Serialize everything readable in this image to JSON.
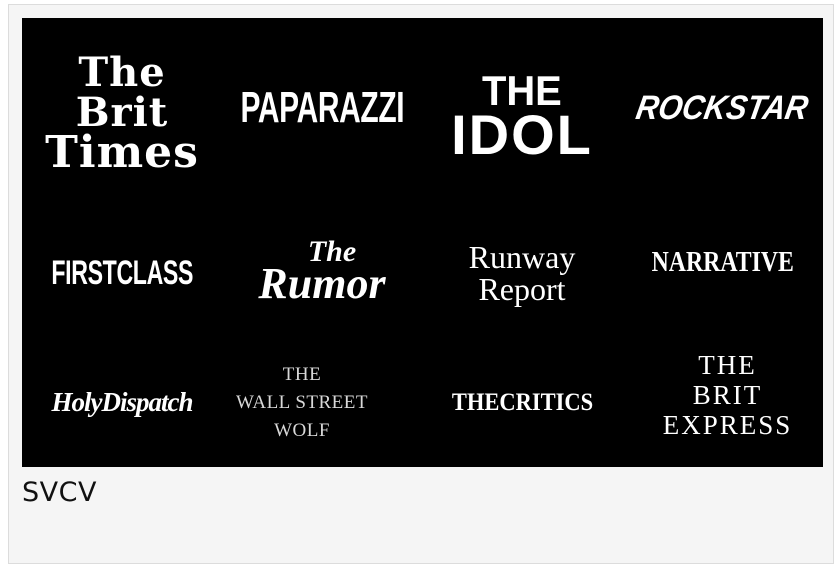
{
  "image": {
    "logos": {
      "brit_times": [
        "The",
        "Brit",
        "Times"
      ],
      "paparazzi": "PAPARAZZI",
      "idol": [
        "THE",
        "IDOL"
      ],
      "rockstar": "ROCKSTAR",
      "firstclass": "FIRSTCLASS",
      "rumor": [
        "The",
        "Rumor"
      ],
      "runway": [
        "Runway",
        "Report"
      ],
      "narrative": "NARRATIVE",
      "holydispatch": "HolyDispatch",
      "wall_street": [
        "THE",
        "WALL STREET",
        "WOLF"
      ],
      "critics": "THECRITICS",
      "brit_express": [
        "THE",
        "BRIT",
        "EXPRESS"
      ]
    }
  },
  "caption": "SVCV"
}
